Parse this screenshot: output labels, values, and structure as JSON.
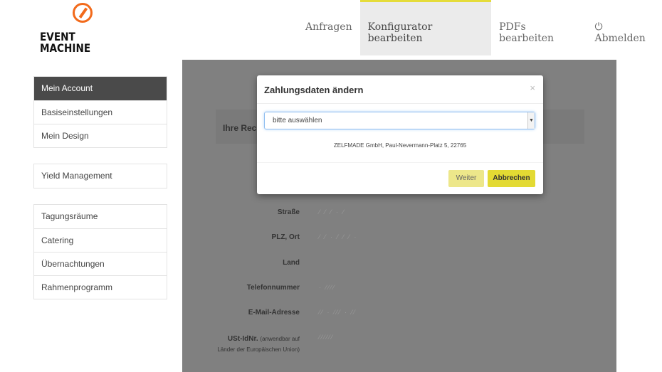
{
  "logo": {
    "text_line1": "EVENT",
    "text_line2": "MACHINE"
  },
  "nav": {
    "items": [
      "Anfragen",
      "Konfigurator bearbeiten",
      "PDFs bearbeiten"
    ],
    "logout": "Abmelden",
    "active_color": "#e5dc3a"
  },
  "sidebar": {
    "groups": [
      [
        "Mein Account",
        "Basiseinstellungen",
        "Mein Design"
      ],
      [
        "Yield Management"
      ],
      [
        "Tagungsräume",
        "Catering",
        "Übernachtungen",
        "Rahmenprogramm"
      ]
    ]
  },
  "main": {
    "panel_title": "Ihre Rec",
    "fields": [
      "Straße",
      "PLZ, Ort",
      "Land",
      "Telefonnummer",
      "E-Mail-Adresse",
      "USt-IdNr."
    ],
    "ust_note": "(anwendbar auf Länder der Europäischen Union)"
  },
  "modal": {
    "title": "Zahlungsdaten ändern",
    "close": "×",
    "select_value": "bitte auswählen",
    "address": "ZELFMADE GmbH, Paul-Nevermann-Platz 5, 22765",
    "weiter": "Weiter",
    "abbrechen": "Abbrechen"
  }
}
